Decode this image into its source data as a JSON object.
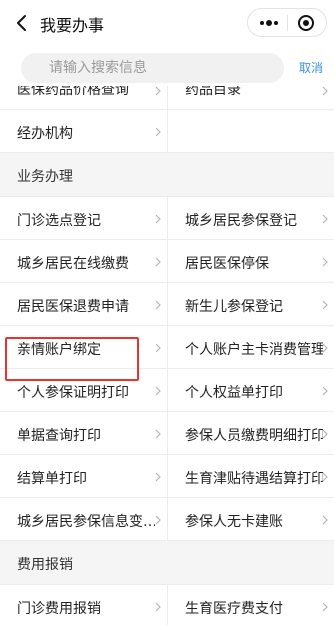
{
  "header": {
    "title": "我要办事"
  },
  "search": {
    "placeholder": "请输入搜索信息",
    "cancel_label": "取消"
  },
  "rows_top": [
    {
      "left": "医保药品价格查询",
      "right": "药品目录"
    }
  ],
  "rows_group0": [
    {
      "left": "经办机构",
      "right": ""
    }
  ],
  "section1": {
    "title": "业务办理"
  },
  "rows_business": [
    {
      "left": "门诊选点登记",
      "right": "城乡居民参保登记"
    },
    {
      "left": "城乡居民在线缴费",
      "right": "居民医保停保"
    },
    {
      "left": "居民医保退费申请",
      "right": "新生儿参保登记"
    },
    {
      "left": "亲情账户绑定",
      "right": "个人账户主卡消费管理"
    },
    {
      "left": "个人参保证明打印",
      "right": "个人权益单打印"
    },
    {
      "left": "单据查询打印",
      "right": "参保人员缴费明细打印"
    },
    {
      "left": "结算单打印",
      "right": "生育津贴待遇结算打印"
    },
    {
      "left": "城乡居民参保信息变…",
      "right": "参保人无卡建账"
    }
  ],
  "section2": {
    "title": "费用报销"
  },
  "rows_bottom": [
    {
      "left": "门诊费用报销",
      "right": "生育医疗费支付"
    }
  ],
  "colors": {
    "accent": "#3b8ce0",
    "highlight": "#e8332e"
  }
}
